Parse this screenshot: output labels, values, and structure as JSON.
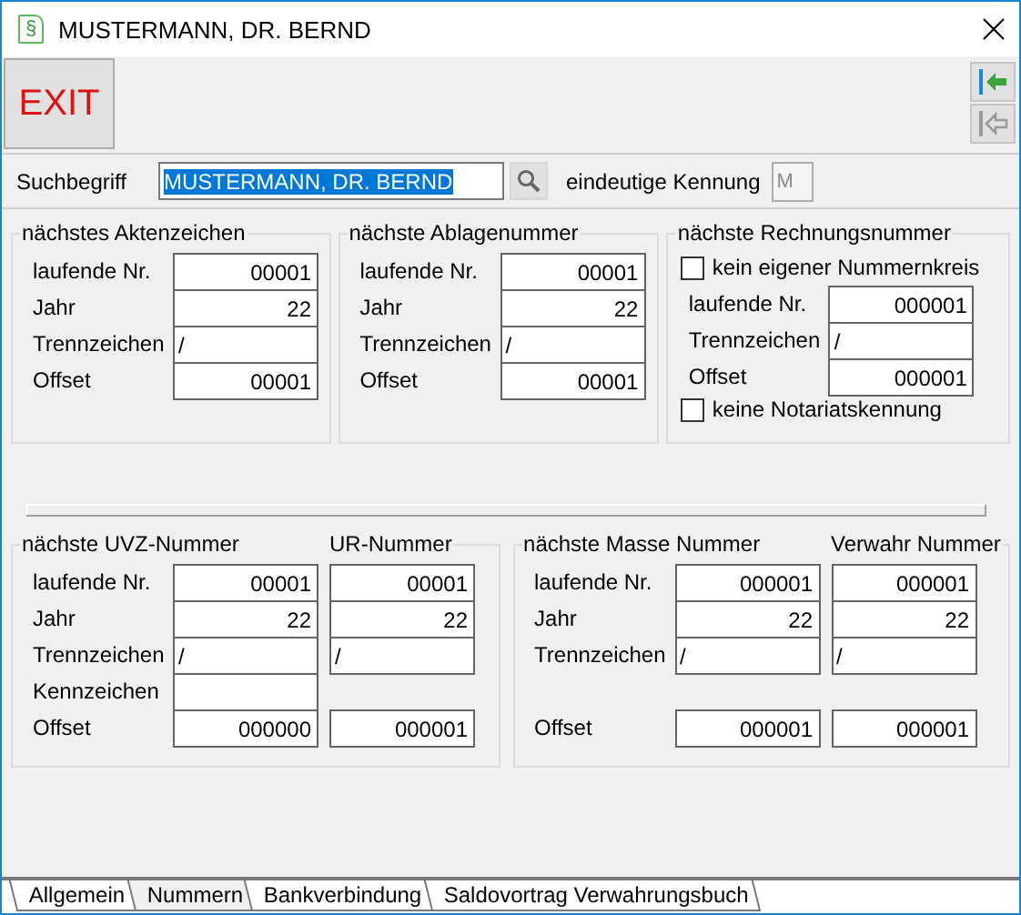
{
  "window": {
    "icon_glyph": "§",
    "title": "MUSTERMANN, DR. BERND"
  },
  "toolbar": {
    "exit_label": "EXIT",
    "nav_buttons": [
      {
        "kind": "first",
        "disabled": false
      },
      {
        "kind": "back",
        "disabled": true
      }
    ]
  },
  "search": {
    "label": "Suchbegriff",
    "value": "MUSTERMANN, DR. BERND",
    "text_selected": true,
    "kennung_label": "eindeutige Kennung",
    "kennung_value": "M",
    "kennung_disabled": true
  },
  "groups_top": [
    {
      "titles": [
        "nächstes Aktenzeichen"
      ],
      "items": [
        {
          "kind": "field",
          "label": "laufende Nr.",
          "cells": [
            {
              "kind": "number",
              "value": "00001"
            }
          ]
        },
        {
          "kind": "field",
          "label": "Jahr",
          "cells": [
            {
              "kind": "number",
              "value": "22"
            }
          ]
        },
        {
          "kind": "field",
          "label": "Trennzeichen",
          "cells": [
            {
              "kind": "text",
              "value": "/"
            }
          ]
        },
        {
          "kind": "field",
          "label": "Offset",
          "cells": [
            {
              "kind": "number",
              "value": "00001"
            }
          ]
        }
      ]
    },
    {
      "titles": [
        "nächste Ablagenummer"
      ],
      "items": [
        {
          "kind": "field",
          "label": "laufende Nr.",
          "cells": [
            {
              "kind": "number",
              "value": "00001"
            }
          ]
        },
        {
          "kind": "field",
          "label": "Jahr",
          "cells": [
            {
              "kind": "number",
              "value": "22"
            }
          ]
        },
        {
          "kind": "field",
          "label": "Trennzeichen",
          "cells": [
            {
              "kind": "text",
              "value": "/"
            }
          ]
        },
        {
          "kind": "field",
          "label": "Offset",
          "cells": [
            {
              "kind": "number",
              "value": "00001"
            }
          ]
        }
      ]
    },
    {
      "titles": [
        "nächste Rechnungsnummer"
      ],
      "items": [
        {
          "kind": "checkbox",
          "label": "kein eigener Nummernkreis",
          "checked": false
        },
        {
          "kind": "field",
          "label": "laufende Nr.",
          "cells": [
            {
              "kind": "number",
              "value": "000001"
            }
          ]
        },
        {
          "kind": "field",
          "label": "Trennzeichen",
          "cells": [
            {
              "kind": "text",
              "value": "/"
            }
          ]
        },
        {
          "kind": "field",
          "label": "Offset",
          "cells": [
            {
              "kind": "number",
              "value": "000001"
            }
          ]
        },
        {
          "kind": "checkbox",
          "label": "keine Notariatskennung",
          "checked": false
        }
      ]
    }
  ],
  "groups_bottom": [
    {
      "titles": [
        "nächste UVZ-Nummer",
        "UR-Nummer"
      ],
      "items": [
        {
          "kind": "field",
          "label": "laufende Nr.",
          "cells": [
            {
              "kind": "number",
              "value": "00001"
            },
            {
              "kind": "number",
              "value": "00001"
            }
          ]
        },
        {
          "kind": "field",
          "label": "Jahr",
          "cells": [
            {
              "kind": "number",
              "value": "22"
            },
            {
              "kind": "number",
              "value": "22"
            }
          ]
        },
        {
          "kind": "field",
          "label": "Trennzeichen",
          "cells": [
            {
              "kind": "text",
              "value": "/"
            },
            {
              "kind": "text",
              "value": "/"
            }
          ]
        },
        {
          "kind": "field",
          "label": "Kennzeichen",
          "cells": [
            {
              "kind": "empty"
            }
          ]
        },
        {
          "kind": "field",
          "label": "Offset",
          "cells": [
            {
              "kind": "number",
              "value": "000000"
            },
            {
              "kind": "number",
              "value": "000001"
            }
          ]
        }
      ]
    },
    {
      "titles": [
        "nächste Masse Nummer",
        "Verwahr Nummer"
      ],
      "items": [
        {
          "kind": "field",
          "label": "laufende Nr.",
          "cells": [
            {
              "kind": "number",
              "value": "000001"
            },
            {
              "kind": "number",
              "value": "000001"
            }
          ]
        },
        {
          "kind": "field",
          "label": "Jahr",
          "cells": [
            {
              "kind": "number",
              "value": "22"
            },
            {
              "kind": "number",
              "value": "22"
            }
          ]
        },
        {
          "kind": "field",
          "label": "Trennzeichen",
          "cells": [
            {
              "kind": "text",
              "value": "/"
            },
            {
              "kind": "text",
              "value": "/"
            }
          ]
        },
        {
          "kind": "gap"
        },
        {
          "kind": "field",
          "label": "Offset",
          "cells": [
            {
              "kind": "number",
              "value": "000001"
            },
            {
              "kind": "number",
              "value": "000001"
            }
          ]
        }
      ]
    }
  ],
  "tabs": [
    {
      "label": "Allgemein",
      "selected": false
    },
    {
      "label": "Nummern",
      "selected": true
    },
    {
      "label": "Bankverbindung",
      "selected": false
    },
    {
      "label": "Saldovortrag Verwahrungsbuch",
      "selected": false
    }
  ]
}
